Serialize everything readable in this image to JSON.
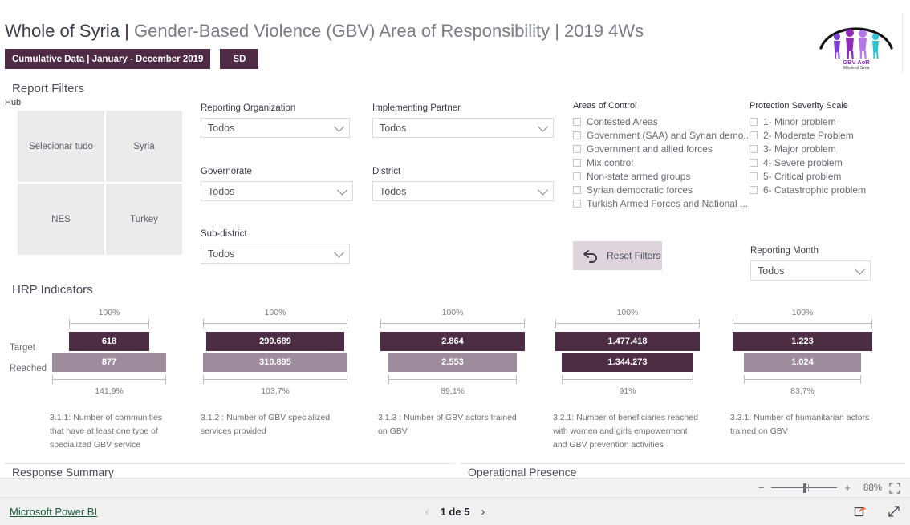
{
  "header": {
    "title_strong": "Whole of Syria",
    "pipe": " | ",
    "title_rest": "Gender-Based Violence (GBV) Area of Responsibility | 2019 4Ws",
    "badge_period": "Cumulative Data | January - December 2019",
    "badge_sd": "SD",
    "logo_name": "GBV AoR",
    "logo_sub": "Whole of Syria"
  },
  "filters": {
    "section_title": "Report Filters",
    "hub_label": "Hub",
    "hub_tiles": [
      {
        "label": "Selecionar tudo"
      },
      {
        "label": "Syria"
      },
      {
        "label": "NES"
      },
      {
        "label": "Turkey"
      }
    ],
    "dropdowns": [
      {
        "label": "Reporting Organization",
        "value": "Todos"
      },
      {
        "label": "Implementing Partner",
        "value": "Todos"
      },
      {
        "label": "Governorate",
        "value": "Todos"
      },
      {
        "label": "District",
        "value": "Todos"
      },
      {
        "label": "Sub-district",
        "value": "Todos"
      },
      {
        "label": "Reporting Month",
        "value": "Todos"
      }
    ],
    "areas_of_control": {
      "title": "Areas of Control",
      "items": [
        "Contested Areas",
        "Government (SAA) and Syrian demo...",
        "Government and allied forces",
        "Mix control",
        "Non-state armed groups",
        "Syrian democratic forces",
        "Turkish Armed Forces and National ..."
      ]
    },
    "protection_severity": {
      "title": "Protection Severity Scale",
      "items": [
        "1- Minor problem",
        "2- Moderate Problem",
        "3- Major problem",
        "4- Severe problem",
        "5- Critical problem",
        "6- Catastrophic problem"
      ]
    },
    "reset_label": "Reset Filters"
  },
  "hrp": {
    "section_title": "HRP Indicators",
    "row_labels": {
      "target": "Target",
      "reached": "Reached"
    },
    "colors": {
      "target": "#4d2d43",
      "reached": "#9d8c9c"
    }
  },
  "chart_data": {
    "type": "bar",
    "title": "HRP Indicators",
    "series": [
      {
        "name": "Target",
        "color": "#4d2d43"
      },
      {
        "name": "Reached",
        "color": "#9d8c9c"
      }
    ],
    "indicators": [
      {
        "code": "3.1.1",
        "caption": "3.1.1:  Number of communities that have at least one type of specialized GBV service",
        "target_label": "618",
        "reached_label": "877",
        "target": 618,
        "reached": 877,
        "top_pct": "100%",
        "bottom_pct": "141,9%",
        "target_width_pct": 68,
        "reached_width_pct": 96.5,
        "reached_color": "#9d8c9c"
      },
      {
        "code": "3.1.2",
        "caption": "3.1.2 : Number of GBV specialized services provided",
        "target_label": "299.689",
        "reached_label": "310.895",
        "target": 299689,
        "reached": 310895,
        "top_pct": "100%",
        "bottom_pct": "103,7%",
        "target_width_pct": 93,
        "reached_width_pct": 96.5,
        "reached_color": "#9d8c9c"
      },
      {
        "code": "3.1.3",
        "caption": "3.1.3 : Number of GBV actors trained on GBV",
        "target_label": "2.864",
        "reached_label": "2.553",
        "target": 2864,
        "reached": 2553,
        "top_pct": "100%",
        "bottom_pct": "89,1%",
        "target_width_pct": 96.5,
        "reached_width_pct": 86,
        "reached_color": "#9d8c9c"
      },
      {
        "code": "3.2.1",
        "caption": "3.2.1: Number of beneficiaries reached with women and girls empowerment and GBV prevention activities",
        "target_label": "1.477.418",
        "reached_label": "1.344.273",
        "target": 1477418,
        "reached": 1344273,
        "top_pct": "100%",
        "bottom_pct": "91%",
        "target_width_pct": 96.5,
        "reached_width_pct": 87.8,
        "reached_color": "#4d2d43"
      },
      {
        "code": "3.3.1",
        "caption": "3.3.1: Number of humanitarian actors trained on GBV",
        "target_label": "1.223",
        "reached_label": "1.024",
        "target": 1223,
        "reached": 1024,
        "top_pct": "100%",
        "bottom_pct": "83,7%",
        "target_width_pct": 96.5,
        "reached_width_pct": 81,
        "reached_color": "#9d8c9c"
      }
    ]
  },
  "bottom_panels": [
    {
      "title": "Response Summary"
    },
    {
      "title": "Operational Presence"
    }
  ],
  "zoombar": {
    "minus": "−",
    "plus": "+",
    "percent": "88%"
  },
  "footer": {
    "brand": "Microsoft Power BI",
    "page_text": "1 de 5",
    "prev": "‹",
    "next": "›"
  }
}
